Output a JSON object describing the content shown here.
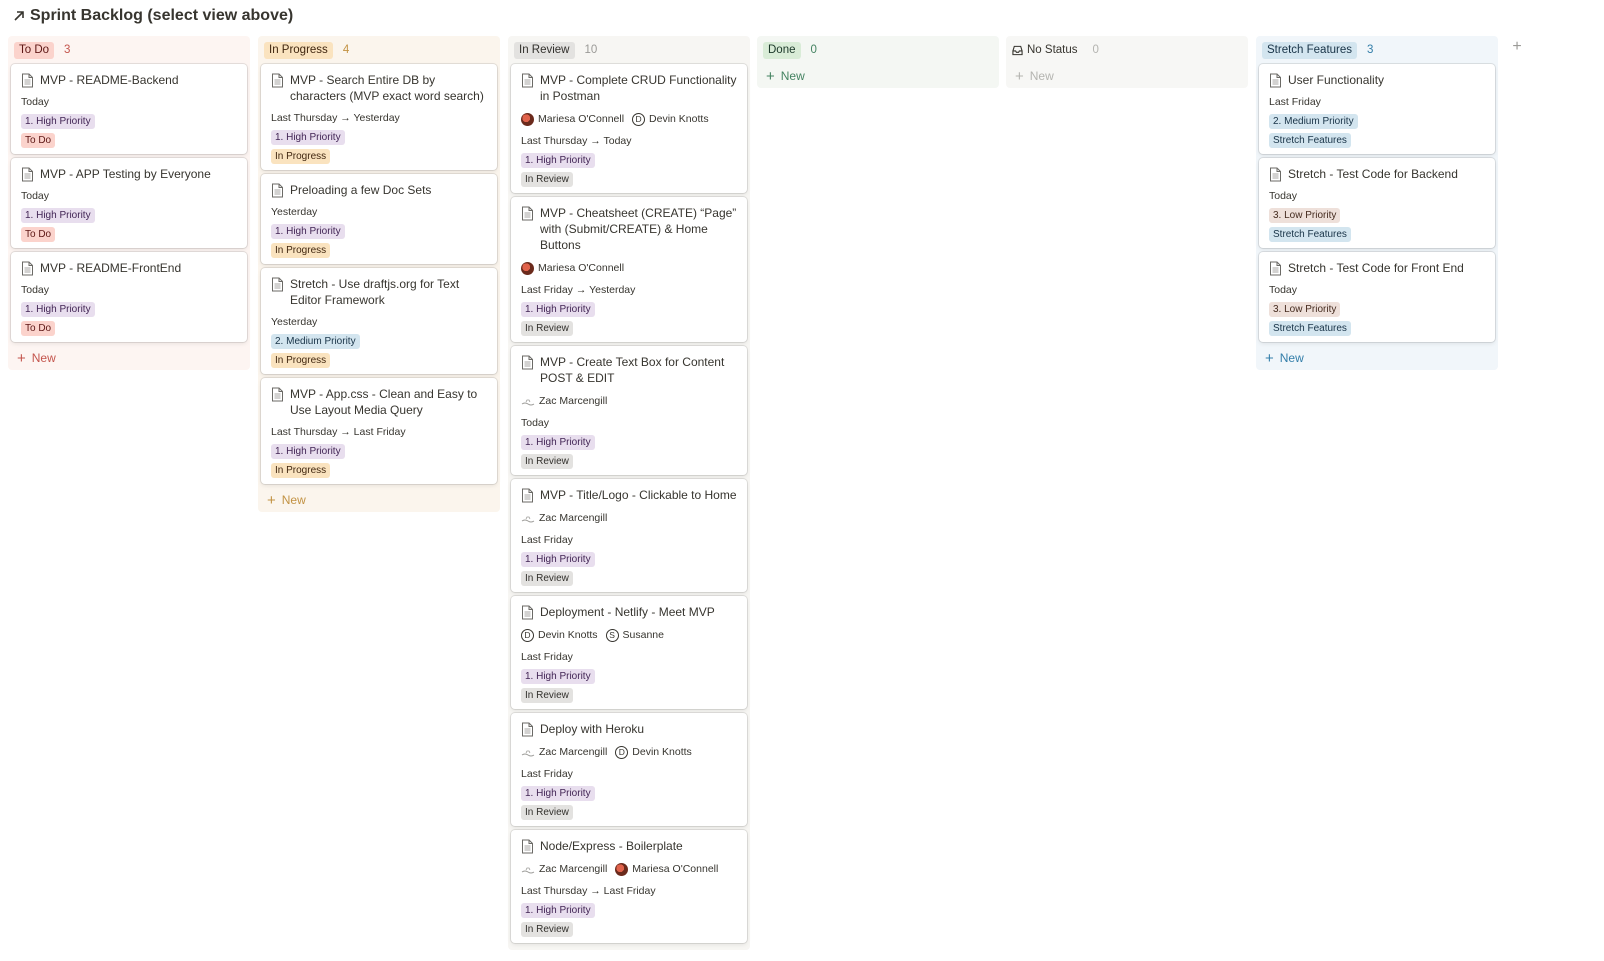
{
  "page": {
    "title": "Sprint Backlog (select view above)"
  },
  "icons": {
    "title": "arrow-up-right-icon",
    "card": "page-icon",
    "no_status": "inbox-icon",
    "add": "plus-icon"
  },
  "colors": {
    "todo": "#c4554d",
    "in_progress": "#c29243",
    "in_review": "#9b9a97",
    "done": "#448361",
    "stretch": "#337ea9"
  },
  "new_label": "New",
  "add_group_label": "+",
  "columns": [
    {
      "key": "todo",
      "label": "To Do",
      "count": "3",
      "show_new": true,
      "cards": [
        {
          "title": "MVP - README-Backend",
          "people": [],
          "date": "Today",
          "priority": "1. High Priority",
          "priority_class": "high",
          "status": "To Do"
        },
        {
          "title": "MVP - APP Testing by Everyone",
          "people": [],
          "date": "Today",
          "priority": "1. High Priority",
          "priority_class": "high",
          "status": "To Do"
        },
        {
          "title": "MVP - README-FrontEnd",
          "people": [],
          "date": "Today",
          "priority": "1. High Priority",
          "priority_class": "high",
          "status": "To Do"
        }
      ]
    },
    {
      "key": "progress",
      "label": "In Progress",
      "count": "4",
      "show_new": true,
      "cards": [
        {
          "title": "MVP - Search Entire DB by characters (MVP exact word search)",
          "people": [],
          "date": "Last Thursday → Yesterday",
          "priority": "1. High Priority",
          "priority_class": "high",
          "status": "In Progress"
        },
        {
          "title": "Preloading a few Doc Sets",
          "people": [],
          "date": "Yesterday",
          "priority": "1. High Priority",
          "priority_class": "high",
          "status": "In Progress"
        },
        {
          "title": "Stretch - Use draftjs.org for Text Editor Framework",
          "people": [],
          "date": "Yesterday",
          "priority": "2. Medium Priority",
          "priority_class": "medium",
          "status": "In Progress"
        },
        {
          "title": "MVP - App.css - Clean and Easy to Use Layout Media Query",
          "people": [],
          "date": "Last Thursday → Last Friday",
          "priority": "1. High Priority",
          "priority_class": "high",
          "status": "In Progress"
        }
      ]
    },
    {
      "key": "review",
      "label": "In Review",
      "count": "10",
      "show_new": false,
      "cards": [
        {
          "title": "MVP - Complete CRUD Functionality in Postman",
          "people": [
            {
              "name": "Mariesa O'Connell",
              "avatar": "photo",
              "initial": ""
            },
            {
              "name": "Devin Knotts",
              "avatar": "letter",
              "initial": "D"
            }
          ],
          "date": "Last Thursday → Today",
          "priority": "1. High Priority",
          "priority_class": "high",
          "status": "In Review"
        },
        {
          "title": "MVP - Cheatsheet (CREATE) “Page” with (Submit/CREATE) & Home Buttons",
          "people": [
            {
              "name": "Mariesa O'Connell",
              "avatar": "photo",
              "initial": ""
            }
          ],
          "date": "Last Friday → Yesterday",
          "priority": "1. High Priority",
          "priority_class": "high",
          "status": "In Review"
        },
        {
          "title": "MVP - Create Text Box for Content POST & EDIT",
          "people": [
            {
              "name": "Zac Marcengill",
              "avatar": "sketch",
              "initial": ""
            }
          ],
          "date": "Today",
          "priority": "1. High Priority",
          "priority_class": "high",
          "status": "In Review"
        },
        {
          "title": "MVP - Title/Logo - Clickable to Home",
          "people": [
            {
              "name": "Zac Marcengill",
              "avatar": "sketch",
              "initial": ""
            }
          ],
          "date": "Last Friday",
          "priority": "1. High Priority",
          "priority_class": "high",
          "status": "In Review"
        },
        {
          "title": "Deployment - Netlify - Meet MVP",
          "people": [
            {
              "name": "Devin Knotts",
              "avatar": "letter",
              "initial": "D"
            },
            {
              "name": "Susanne",
              "avatar": "letter",
              "initial": "S"
            }
          ],
          "date": "Last Friday",
          "priority": "1. High Priority",
          "priority_class": "high",
          "status": "In Review"
        },
        {
          "title": "Deploy with Heroku",
          "people": [
            {
              "name": "Zac Marcengill",
              "avatar": "sketch",
              "initial": ""
            },
            {
              "name": "Devin Knotts",
              "avatar": "letter",
              "initial": "D"
            }
          ],
          "date": "Last Friday",
          "priority": "1. High Priority",
          "priority_class": "high",
          "status": "In Review"
        },
        {
          "title": "Node/Express - Boilerplate",
          "people": [
            {
              "name": "Zac Marcengill",
              "avatar": "sketch",
              "initial": ""
            },
            {
              "name": "Mariesa O'Connell",
              "avatar": "photo",
              "initial": ""
            }
          ],
          "date": "Last Thursday → Last Friday",
          "priority": "1. High Priority",
          "priority_class": "high",
          "status": "In Review"
        }
      ]
    },
    {
      "key": "done",
      "label": "Done",
      "count": "0",
      "show_new": true,
      "cards": []
    },
    {
      "key": "nostatus",
      "label": "No Status",
      "count": "0",
      "show_new": true,
      "cards": []
    },
    {
      "key": "stretch",
      "label": "Stretch Features",
      "count": "3",
      "show_new": true,
      "cards": [
        {
          "title": "User Functionality",
          "people": [],
          "date": "Last Friday",
          "priority": "2. Medium Priority",
          "priority_class": "medium",
          "status": "Stretch Features"
        },
        {
          "title": "Stretch - Test Code for Backend",
          "people": [],
          "date": "Today",
          "priority": "3. Low Priority",
          "priority_class": "low",
          "status": "Stretch Features"
        },
        {
          "title": "Stretch - Test Code for Front End",
          "people": [],
          "date": "Today",
          "priority": "3. Low Priority",
          "priority_class": "low",
          "status": "Stretch Features"
        }
      ]
    }
  ]
}
